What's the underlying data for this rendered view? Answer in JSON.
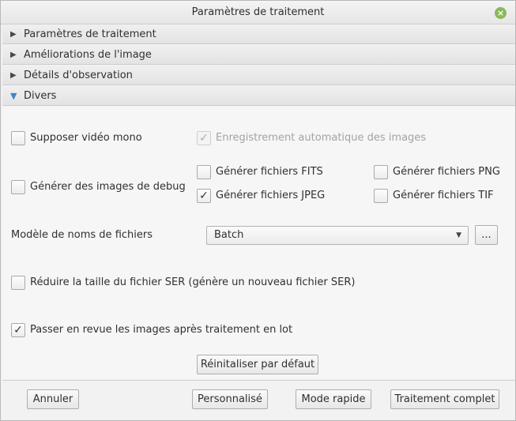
{
  "window": {
    "title": "Paramètres de traitement"
  },
  "accordion": [
    {
      "label": "Paramètres de traitement",
      "expanded": false
    },
    {
      "label": "Améliorations de l'image",
      "expanded": false
    },
    {
      "label": "Détails d'observation",
      "expanded": false
    },
    {
      "label": "Divers",
      "expanded": true
    }
  ],
  "divers": {
    "mono_video": {
      "label": "Supposer vidéo mono",
      "checked": false
    },
    "auto_save": {
      "label": "Enregistrement automatique des images",
      "checked": true,
      "enabled": false
    },
    "debug_images": {
      "label": "Générer des images de debug",
      "checked": false
    },
    "fits": {
      "label": "Générer fichiers FITS",
      "checked": false
    },
    "png": {
      "label": "Générer fichiers PNG",
      "checked": false
    },
    "jpeg": {
      "label": "Générer fichiers JPEG",
      "checked": true
    },
    "tif": {
      "label": "Générer fichiers TIF",
      "checked": false
    },
    "filename_pattern": {
      "label": "Modèle de noms de fichiers",
      "value": "Batch",
      "browse_label": "..."
    },
    "reduce_ser": {
      "label": "Réduire la taille du fichier SER (génère un nouveau fichier SER)",
      "checked": false
    },
    "review_images": {
      "label": "Passer en revue les images après traitement en lot",
      "checked": true
    },
    "reset_label": "Réinitaliser par défaut"
  },
  "footer": {
    "cancel": "Annuler",
    "custom": "Personnalisé",
    "quick": "Mode rapide",
    "full": "Traitement complet"
  },
  "icons": {
    "check": "✓",
    "expand_closed": "▶",
    "expand_open": "▼",
    "close": "×",
    "dropdown": "▼"
  }
}
